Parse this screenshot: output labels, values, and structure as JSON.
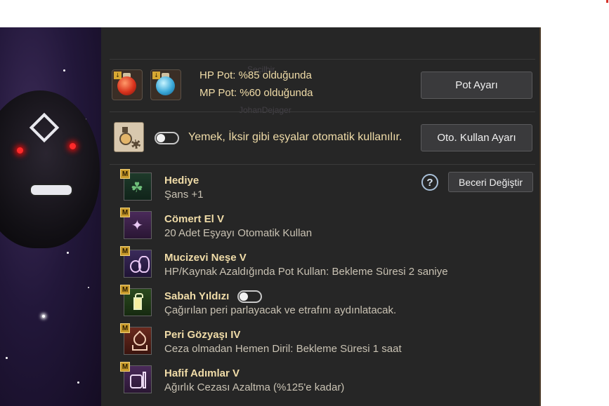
{
  "colors": {
    "panel_bg": "#262626",
    "gold_text": "#f0dca8",
    "desc_text": "#c9c2b3",
    "badge": "#c89a2a"
  },
  "potions": {
    "hp_text": "HP Pot: %85 olduğunda",
    "mp_text": "MP Pot: %60 olduğunda",
    "settings_button": "Pot Ayarı"
  },
  "auto_use": {
    "label": "Yemek, İksir gibi eşyalar otomatik kullanılır.",
    "toggle_on": false,
    "settings_button": "Oto. Kullan Ayarı"
  },
  "skills_header": {
    "help_icon": "?",
    "change_button": "Beceri Değiştir"
  },
  "skills": [
    {
      "badge": "M",
      "name": "Hediye",
      "desc": "Şans +1",
      "icon": "clover-icon"
    },
    {
      "badge": "M",
      "name": "Cömert El V",
      "desc": "20 Adet Eşyayı Otomatik Kullan",
      "icon": "fairy-icon"
    },
    {
      "badge": "M",
      "name": "Mucizevi Neşe V",
      "desc": "HP/Kaynak Azaldığında Pot Kullan: Bekleme Süresi 2 saniye",
      "icon": "potions-icon"
    },
    {
      "badge": "M",
      "name": "Sabah Yıldızı",
      "desc": "Çağırılan peri parlayacak ve etrafını aydınlatacak.",
      "icon": "lantern-icon",
      "toggle_on": false
    },
    {
      "badge": "M",
      "name": "Peri Gözyaşı IV",
      "desc": "Ceza olmadan Hemen Diril: Bekleme Süresi 1 saat",
      "icon": "tear-icon"
    },
    {
      "badge": "M",
      "name": "Hafif Adımlar V",
      "desc": "Ağırlık Cezası Azaltma (%125'e kadar)",
      "icon": "bag-icon"
    }
  ]
}
